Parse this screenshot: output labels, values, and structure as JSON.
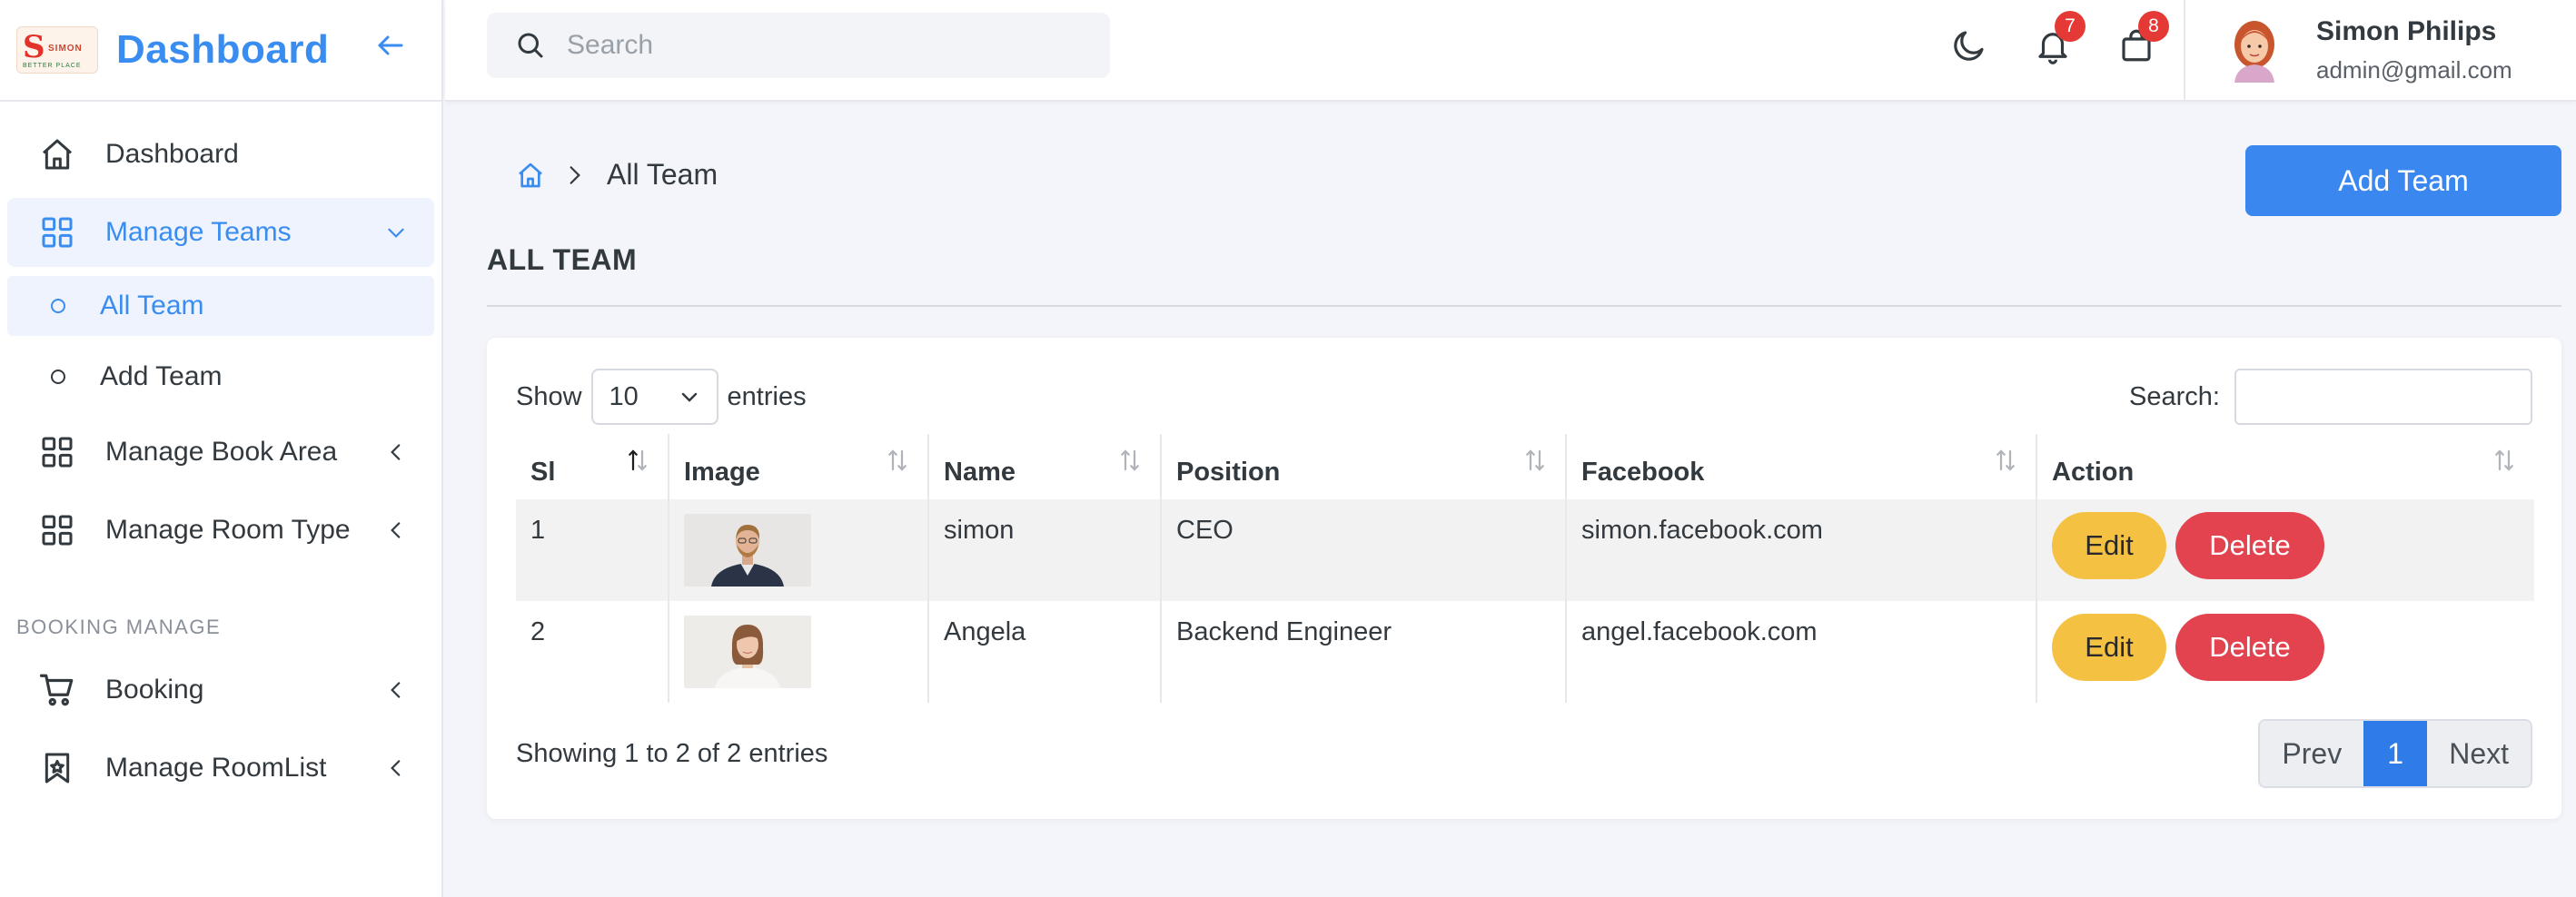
{
  "brand": {
    "title": "Dashboard",
    "logo_letter": "S",
    "logo_word": "SIMON",
    "logo_tagline": "BETTER PLACE"
  },
  "sidebar": {
    "items": [
      {
        "label": "Dashboard",
        "icon": "home-icon"
      },
      {
        "label": "Manage Teams",
        "icon": "grid-icon",
        "expanded": true,
        "children": [
          {
            "label": "All Team",
            "active": true
          },
          {
            "label": "Add Team",
            "active": false
          }
        ]
      },
      {
        "label": "Manage Book Area",
        "icon": "grid-icon"
      },
      {
        "label": "Manage Room Type",
        "icon": "grid-icon"
      }
    ],
    "section_label": "BOOKING MANAGE",
    "booking_items": [
      {
        "label": "Booking",
        "icon": "cart-icon"
      },
      {
        "label": "Manage RoomList",
        "icon": "bookmark-icon"
      }
    ]
  },
  "topbar": {
    "search_placeholder": "Search",
    "notifications_count": "7",
    "cart_count": "8",
    "user_name": "Simon Philips",
    "user_email": "admin@gmail.com"
  },
  "page": {
    "breadcrumb_current": "All Team",
    "add_button": "Add Team",
    "heading": "ALL TEAM"
  },
  "table": {
    "show_label": "Show",
    "entries_value": "10",
    "entries_label": "entries",
    "search_label": "Search:",
    "columns": [
      "Sl",
      "Image",
      "Name",
      "Position",
      "Facebook",
      "Action"
    ],
    "rows": [
      {
        "sl": "1",
        "name": "simon",
        "position": "CEO",
        "facebook": "simon.facebook.com"
      },
      {
        "sl": "2",
        "name": "Angela",
        "position": "Backend Engineer",
        "facebook": "angel.facebook.com"
      }
    ],
    "edit_label": "Edit",
    "delete_label": "Delete",
    "info": "Showing 1 to 2 of 2 entries",
    "pager": {
      "prev": "Prev",
      "current": "1",
      "next": "Next"
    }
  },
  "colors": {
    "accent": "#3a8df0",
    "edit": "#f5c143",
    "delete": "#e2434f",
    "badge": "#e53935"
  }
}
